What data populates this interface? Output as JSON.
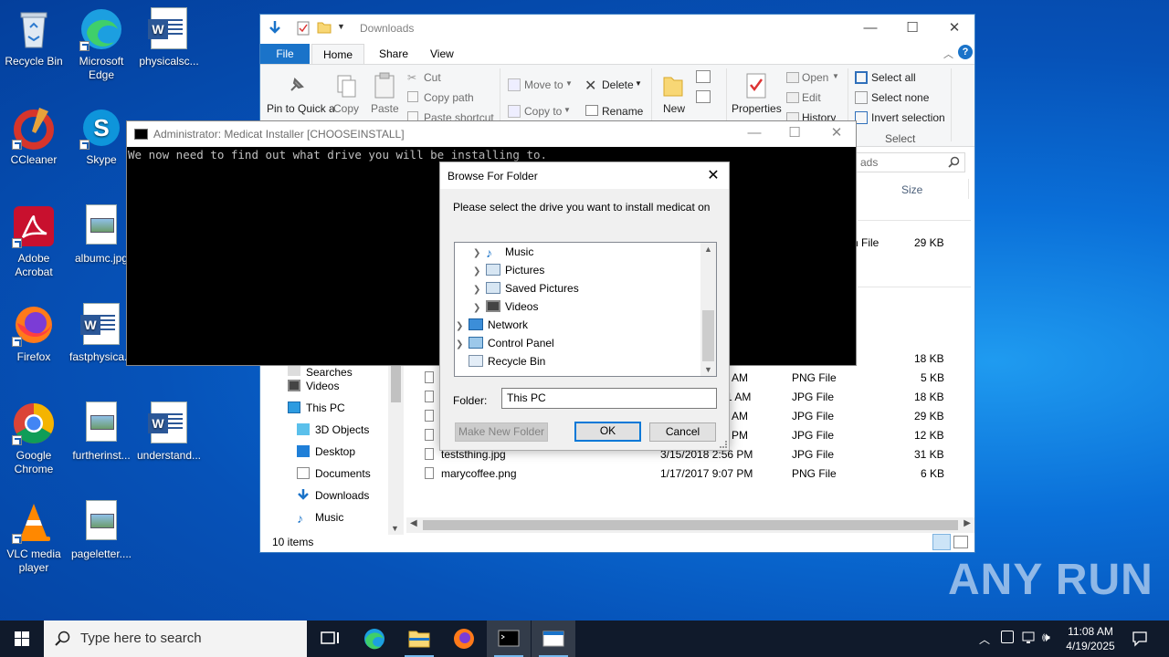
{
  "desktop": {
    "icons": [
      {
        "label": "Recycle Bin"
      },
      {
        "label": "Microsoft Edge"
      },
      {
        "label": "physicalsc..."
      },
      {
        "label": "CCleaner"
      },
      {
        "label": "Skype"
      },
      {
        "label": "Adobe Acrobat"
      },
      {
        "label": "albumc.jpg"
      },
      {
        "label": "Firefox"
      },
      {
        "label": "fastphysica..."
      },
      {
        "label": "Google Chrome"
      },
      {
        "label": "furtherinst..."
      },
      {
        "label": "understand..."
      },
      {
        "label": "VLC media player"
      },
      {
        "label": "pageletter...."
      }
    ]
  },
  "explorer": {
    "title": "Downloads",
    "tabs": {
      "file": "File",
      "home": "Home",
      "share": "Share",
      "view": "View"
    },
    "ribbon": {
      "pin": "Pin to Quick access",
      "copy": "Copy",
      "paste": "Paste",
      "cut": "Cut",
      "copy_path": "Copy path",
      "paste_shortcut": "Paste shortcut",
      "move_to": "Move to",
      "copy_to": "Copy to",
      "delete": "Delete",
      "rename": "Rename",
      "new_folder": "New folder",
      "properties": "Properties",
      "open": "Open",
      "edit": "Edit",
      "history": "History",
      "select_all": "Select all",
      "select_none": "Select none",
      "invert_selection": "Invert selection",
      "select_group": "Select"
    },
    "search_placeholder": "ads",
    "col_size": "Size",
    "nav": [
      "Searches",
      "Videos",
      "This PC",
      "3D Objects",
      "Desktop",
      "Documents",
      "Downloads",
      "Music"
    ],
    "files": [
      {
        "name": "",
        "date": "",
        "type": "ch File",
        "size": "29 KB"
      },
      {
        "name": "",
        "date": "",
        "type": "",
        "size": "18 KB"
      },
      {
        "name": "",
        "date": "AM",
        "type": "PNG File",
        "size": "5 KB"
      },
      {
        "name": "",
        "date": "1 AM",
        "type": "JPG File",
        "size": "18 KB"
      },
      {
        "name": "",
        "date": "AM",
        "type": "JPG File",
        "size": "29 KB"
      },
      {
        "name": "",
        "date": "PM",
        "type": "JPG File",
        "size": "12 KB"
      },
      {
        "name": "teststhing.jpg",
        "date": "3/15/2018 2:56 PM",
        "type": "JPG File",
        "size": "31 KB"
      },
      {
        "name": "marycoffee.png",
        "date": "1/17/2017 9:07 PM",
        "type": "PNG File",
        "size": "6 KB"
      }
    ],
    "status": "10 items"
  },
  "console": {
    "title": "Administrator:  Medicat Installer [CHOOSEINSTALL]",
    "text": "We now need to find out what drive you will be installing to."
  },
  "dialog": {
    "title": "Browse For Folder",
    "prompt": "Please select the drive you want to install medicat on",
    "tree": [
      "Music",
      "Pictures",
      "Saved Pictures",
      "Videos",
      "Network",
      "Control Panel",
      "Recycle Bin"
    ],
    "folder_label": "Folder:",
    "folder_value": "This PC",
    "make_new_folder": "Make New Folder",
    "ok": "OK",
    "cancel": "Cancel"
  },
  "taskbar": {
    "search_placeholder": "Type here to search",
    "time": "11:08 AM",
    "date": "4/19/2025"
  },
  "watermark": "ANY RUN",
  "colors": {
    "accent": "#0078d7",
    "file_tab": "#1a73c9",
    "taskbar": "#101a2b"
  }
}
